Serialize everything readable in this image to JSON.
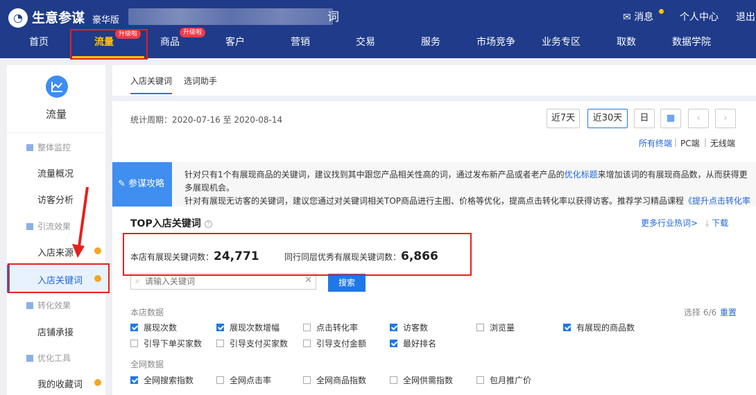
{
  "header": {
    "app_title": "生意参谋",
    "edition": "豪华版",
    "title_tail": "词",
    "messages": "消息",
    "personal_center": "个人中心",
    "logout": "退出"
  },
  "nav": {
    "items": [
      "首页",
      "流量",
      "商品",
      "客户",
      "营销",
      "交易",
      "服务",
      "市场竞争",
      "业务专区",
      "取数",
      "数据学院"
    ],
    "badge_traffic": "升级啦",
    "badge_goods": "升级啦"
  },
  "sidebar": {
    "title": "流量",
    "groups": {
      "overall": "整体监控",
      "traffic_overview": "流量概况",
      "visitor_analysis": "访客分析",
      "traffic_effect": "引流效果",
      "store_source": "入店来源",
      "store_keywords": "入店关键词",
      "conversion": "转化效果",
      "store_landing": "店铺承接",
      "optimize_tools": "优化工具",
      "my_keywords": "我的收藏词"
    }
  },
  "tabs": [
    "入店关键词",
    "选词助手"
  ],
  "period": {
    "label": "统计周期：2020-07-16 至 2020-08-14",
    "buttons": [
      "近7天",
      "近30天",
      "日"
    ]
  },
  "terminals": {
    "all": "所有终端",
    "pc": "PC端",
    "wireless": "无线端"
  },
  "tip": {
    "label": "参谋攻略",
    "line1_a": "针对只有1个有展现商品的关键词，建议找到其中跟您产品相关性高的词，通过发布新产品或者老产品的",
    "line1_link": "优化标题",
    "line1_b": "来增加该词的有展现商品数，从而获得更",
    "line2": "多展现机会。",
    "line3_a": "针对有展现无访客的关键词，建议您通过对关键词相关TOP商品进行主图、价格等优化，提高点击转化率以获得访客。推荐学习精品课程",
    "line3_link": "《提升点击转化率"
  },
  "section": {
    "title": "TOP入店关键词",
    "more_hot": "更多行业热词>",
    "download": "下载",
    "store_kw_label": "本店有展现关键词数：",
    "store_kw_value": "24,771",
    "peer_kw_label": "同行同层优秀有展现关键词数：",
    "peer_kw_value": "6,866",
    "search_placeholder": "请输入关键词",
    "search_btn": "搜索",
    "select_count": "选择 6/6",
    "reset": "重置"
  },
  "store_data": {
    "label": "本店数据",
    "items": [
      {
        "label": "展现次数",
        "checked": true
      },
      {
        "label": "展现次数增幅",
        "checked": true
      },
      {
        "label": "点击转化率",
        "checked": false
      },
      {
        "label": "访客数",
        "checked": true
      },
      {
        "label": "浏览量",
        "checked": false
      },
      {
        "label": "有展现的商品数",
        "checked": true
      },
      {
        "label": "引导下单买家数",
        "checked": false
      },
      {
        "label": "引导支付买家数",
        "checked": false
      },
      {
        "label": "引导支付金额",
        "checked": false
      },
      {
        "label": "最好排名",
        "checked": true
      }
    ]
  },
  "network_data": {
    "label": "全网数据",
    "items": [
      {
        "label": "全网搜索指数",
        "checked": true
      },
      {
        "label": "全网点击率",
        "checked": false
      },
      {
        "label": "全网商品指数",
        "checked": false
      },
      {
        "label": "全网供需指数",
        "checked": false
      },
      {
        "label": "包月推广价",
        "checked": false
      }
    ]
  }
}
